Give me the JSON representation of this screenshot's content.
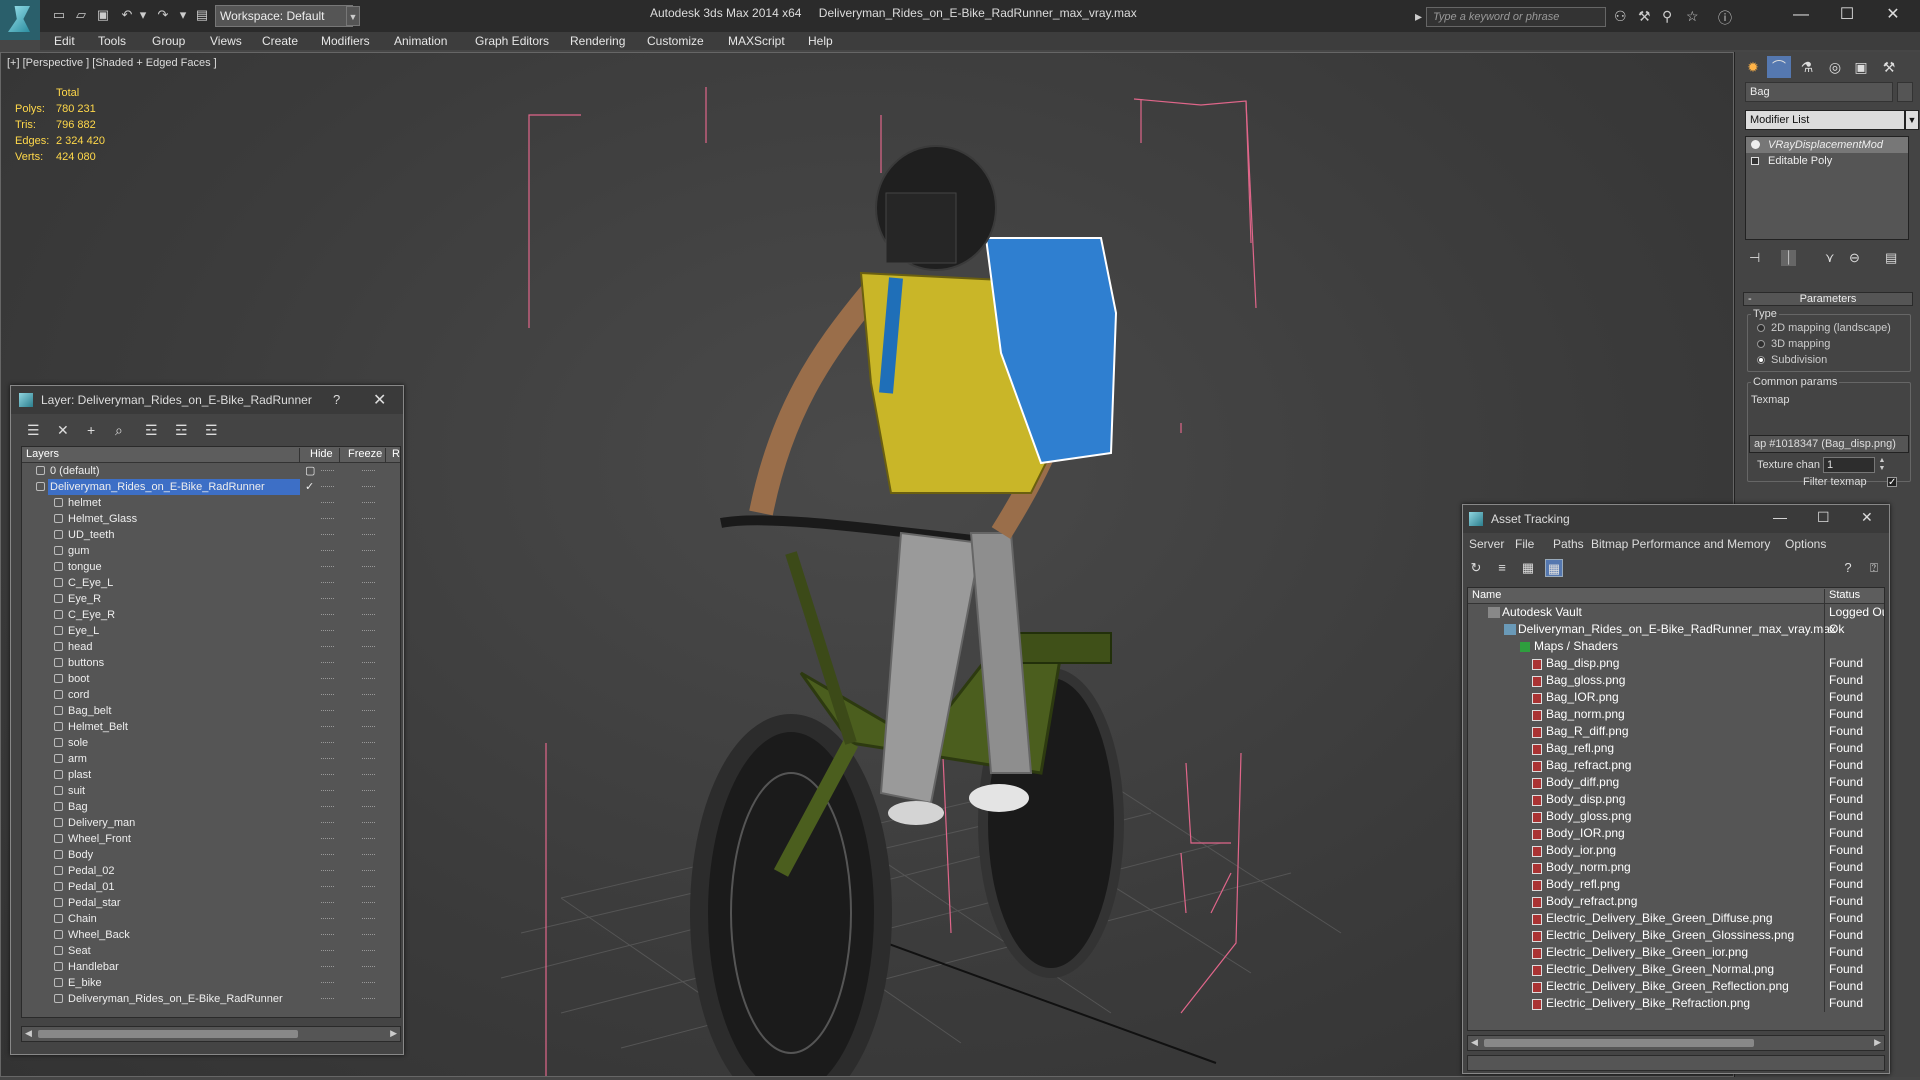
{
  "titlebar": {
    "workspace": "Workspace: Default",
    "app_name": "Autodesk 3ds Max  2014 x64",
    "file_name": "Deliveryman_Rides_on_E-Bike_RadRunner_max_vray.max",
    "search_placeholder": "Type a keyword or phrase"
  },
  "menu": [
    "Edit",
    "Tools",
    "Group",
    "Views",
    "Create",
    "Modifiers",
    "Animation",
    "Graph Editors",
    "Rendering",
    "Customize",
    "MAXScript",
    "Help"
  ],
  "viewport": {
    "label": "[+] [Perspective ] [Shaded + Edged Faces ]",
    "stats": {
      "header": "Total",
      "polys_label": "Polys:",
      "polys": "780 231",
      "tris_label": "Tris:",
      "tris": "796 882",
      "edges_label": "Edges:",
      "edges": "2 324 420",
      "verts_label": "Verts:",
      "verts": "424 080"
    }
  },
  "command_panel": {
    "object_name": "Bag",
    "modifier_list": "Modifier List",
    "stack": [
      "VRayDisplacementMod",
      "Editable Poly"
    ],
    "parameters_title": "Parameters",
    "type_label": "Type",
    "type_options": [
      "2D mapping (landscape)",
      "3D mapping",
      "Subdivision"
    ],
    "type_selected": "Subdivision",
    "common_params": "Common params",
    "texmap_label": "Texmap",
    "texmap_value": "ap #1018347 (Bag_disp.png)",
    "texture_chan_label": "Texture chan",
    "texture_chan_value": "1",
    "filter_texmap_label": "Filter texmap",
    "filter_texmap_checked": "✓"
  },
  "layer_dialog": {
    "title": "Layer: Deliveryman_Rides_on_E-Bike_RadRunner",
    "help": "?",
    "close": "✕",
    "columns": [
      "Layers",
      "Hide",
      "Freeze",
      "R"
    ],
    "layers": [
      {
        "name": "0 (default)",
        "level": 0
      },
      {
        "name": "Deliveryman_Rides_on_E-Bike_RadRunner",
        "level": 0,
        "selected": true
      },
      {
        "name": "helmet",
        "level": 1
      },
      {
        "name": "Helmet_Glass",
        "level": 1
      },
      {
        "name": "UD_teeth",
        "level": 1
      },
      {
        "name": "gum",
        "level": 1
      },
      {
        "name": "tongue",
        "level": 1
      },
      {
        "name": "C_Eye_L",
        "level": 1
      },
      {
        "name": "Eye_R",
        "level": 1
      },
      {
        "name": "C_Eye_R",
        "level": 1
      },
      {
        "name": "Eye_L",
        "level": 1
      },
      {
        "name": "head",
        "level": 1
      },
      {
        "name": "buttons",
        "level": 1
      },
      {
        "name": "boot",
        "level": 1
      },
      {
        "name": "cord",
        "level": 1
      },
      {
        "name": "Bag_belt",
        "level": 1
      },
      {
        "name": "Helmet_Belt",
        "level": 1
      },
      {
        "name": "sole",
        "level": 1
      },
      {
        "name": "arm",
        "level": 1
      },
      {
        "name": "plast",
        "level": 1
      },
      {
        "name": "suit",
        "level": 1
      },
      {
        "name": "Bag",
        "level": 1
      },
      {
        "name": "Delivery_man",
        "level": 1
      },
      {
        "name": "Wheel_Front",
        "level": 1
      },
      {
        "name": "Body",
        "level": 1
      },
      {
        "name": "Pedal_02",
        "level": 1
      },
      {
        "name": "Pedal_01",
        "level": 1
      },
      {
        "name": "Pedal_star",
        "level": 1
      },
      {
        "name": "Chain",
        "level": 1
      },
      {
        "name": "Wheel_Back",
        "level": 1
      },
      {
        "name": "Seat",
        "level": 1
      },
      {
        "name": "Handlebar",
        "level": 1
      },
      {
        "name": "E_bike",
        "level": 1
      },
      {
        "name": "Deliveryman_Rides_on_E-Bike_RadRunner",
        "level": 1
      }
    ]
  },
  "asset_dialog": {
    "title": "Asset Tracking",
    "menu": [
      "Server",
      "File",
      "Paths",
      "Bitmap Performance and Memory",
      "Options"
    ],
    "columns": [
      "Name",
      "Status"
    ],
    "rows": [
      {
        "name": "Autodesk Vault",
        "status": "Logged Ou",
        "kind": "vault",
        "level": 0
      },
      {
        "name": "Deliveryman_Rides_on_E-Bike_RadRunner_max_vray.max",
        "status": "Ok",
        "kind": "max",
        "level": 1
      },
      {
        "name": "Maps / Shaders",
        "status": "",
        "kind": "folder",
        "level": 2
      },
      {
        "name": "Bag_disp.png",
        "status": "Found",
        "kind": "file",
        "level": 3
      },
      {
        "name": "Bag_gloss.png",
        "status": "Found",
        "kind": "file",
        "level": 3
      },
      {
        "name": "Bag_IOR.png",
        "status": "Found",
        "kind": "file",
        "level": 3
      },
      {
        "name": "Bag_norm.png",
        "status": "Found",
        "kind": "file",
        "level": 3
      },
      {
        "name": "Bag_R_diff.png",
        "status": "Found",
        "kind": "file",
        "level": 3
      },
      {
        "name": "Bag_refl.png",
        "status": "Found",
        "kind": "file",
        "level": 3
      },
      {
        "name": "Bag_refract.png",
        "status": "Found",
        "kind": "file",
        "level": 3
      },
      {
        "name": "Body_diff.png",
        "status": "Found",
        "kind": "file",
        "level": 3
      },
      {
        "name": "Body_disp.png",
        "status": "Found",
        "kind": "file",
        "level": 3
      },
      {
        "name": "Body_gloss.png",
        "status": "Found",
        "kind": "file",
        "level": 3
      },
      {
        "name": "Body_IOR.png",
        "status": "Found",
        "kind": "file",
        "level": 3
      },
      {
        "name": "Body_ior.png",
        "status": "Found",
        "kind": "file",
        "level": 3
      },
      {
        "name": "Body_norm.png",
        "status": "Found",
        "kind": "file",
        "level": 3
      },
      {
        "name": "Body_refl.png",
        "status": "Found",
        "kind": "file",
        "level": 3
      },
      {
        "name": "Body_refract.png",
        "status": "Found",
        "kind": "file",
        "level": 3
      },
      {
        "name": "Electric_Delivery_Bike_Green_Diffuse.png",
        "status": "Found",
        "kind": "file",
        "level": 3
      },
      {
        "name": "Electric_Delivery_Bike_Green_Glossiness.png",
        "status": "Found",
        "kind": "file",
        "level": 3
      },
      {
        "name": "Electric_Delivery_Bike_Green_ior.png",
        "status": "Found",
        "kind": "file",
        "level": 3
      },
      {
        "name": "Electric_Delivery_Bike_Green_Normal.png",
        "status": "Found",
        "kind": "file",
        "level": 3
      },
      {
        "name": "Electric_Delivery_Bike_Green_Reflection.png",
        "status": "Found",
        "kind": "file",
        "level": 3
      },
      {
        "name": "Electric_Delivery_Bike_Refraction.png",
        "status": "Found",
        "kind": "file",
        "level": 3
      }
    ]
  },
  "colors": {
    "selection": "#3d6fc6",
    "stats_text": "#ffd84a",
    "bbox_lines": "#e0668a"
  }
}
